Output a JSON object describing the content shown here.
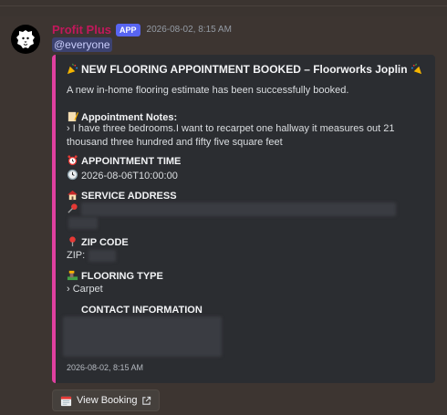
{
  "message": {
    "author": "Profit Plus",
    "badge": "APP",
    "timestamp": "2026-08-02, 8:15 AM",
    "mention": "@everyone"
  },
  "embed": {
    "title": "NEW FLOORING APPOINTMENT BOOKED – Floorworks Joplin",
    "description": "A new in-home flooring estimate has been successfully booked.",
    "notes_label": "Appointment Notes:",
    "notes_line1": "› I have three bedrooms.I want to recarpet one hallway it measures out 21",
    "notes_line2": "thousand three hundred and fifty five square feet",
    "time_label": "APPOINTMENT TIME",
    "time_value": "2026-08-06T10:00:00",
    "address_label": "SERVICE ADDRESS",
    "zip_label": "ZIP CODE",
    "zip_prefix": "ZIP:",
    "flooring_label": "FLOORING TYPE",
    "flooring_value": "› Carpet",
    "contact_label": "CONTACT INFORMATION",
    "footer": "2026-08-02, 8:15 AM",
    "accent_color": "#e040a0"
  },
  "button": {
    "label": "View Booking"
  },
  "icons": [
    "lion-avatar-icon",
    "party-popper-icon",
    "memo-icon",
    "alarm-clock-icon",
    "clock-icon",
    "house-icon",
    "pushpin-icon",
    "round-pushpin-icon",
    "flooring-icon",
    "calendar-icon",
    "external-link-icon"
  ]
}
